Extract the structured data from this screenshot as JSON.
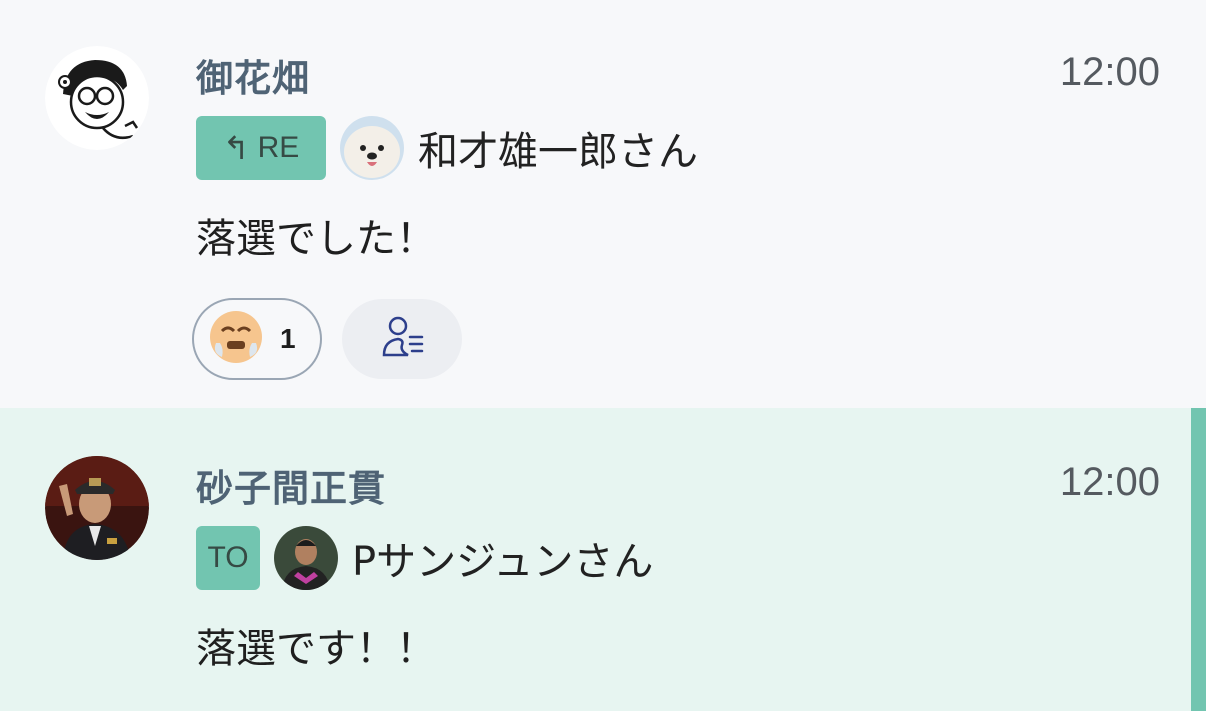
{
  "messages": [
    {
      "sender": "御花畑",
      "time": "12:00",
      "reply_tag": "RE",
      "reply_target": "和才雄一郎さん",
      "body": "落選でした！",
      "reaction": {
        "icon": "crying-face-icon",
        "count": "1"
      },
      "readers_icon": "read-members-icon"
    },
    {
      "sender": "砂子間正貫",
      "time": "12:00",
      "reply_tag": "TO",
      "reply_target": "Pサンジュンさん",
      "body": "落選です！！"
    }
  ],
  "colors": {
    "tag_bg": "#72c5b0",
    "highlight_bg": "#e7f5f1",
    "accent_bar": "#72c5b0",
    "sender_text": "#4f6375"
  }
}
